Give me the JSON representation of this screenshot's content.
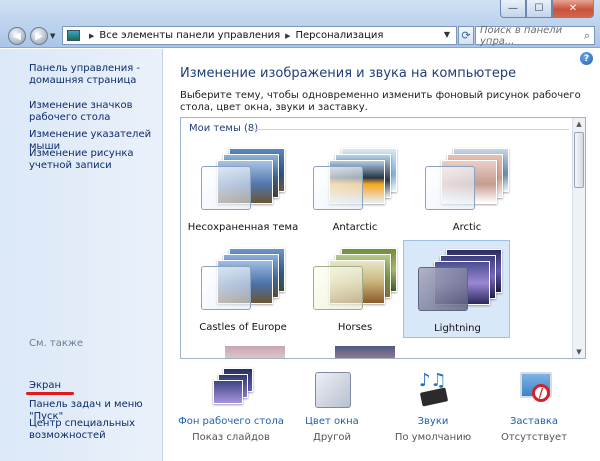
{
  "window": {
    "minimize_glyph": "—",
    "maximize_glyph": "☐",
    "close_glyph": "✕"
  },
  "nav": {
    "back_icon": "arrow-left-icon",
    "forward_icon": "arrow-right-icon",
    "breadcrumb": [
      "Все элементы панели управления",
      "Персонализация"
    ],
    "search_placeholder": "Поиск в панели упра..."
  },
  "sidebar": {
    "links": [
      "Панель управления - домашняя страница",
      "Изменение значков рабочего стола",
      "Изменение указателей мыши",
      "Изменение рисунка учетной записи"
    ],
    "see_also_label": "См. также",
    "see_also_links": [
      "Экран",
      "Панель задач и меню \"Пуск\"",
      "Центр специальных возможностей"
    ],
    "highlight_color": "#e0191a"
  },
  "main": {
    "title": "Изменение изображения и звука на компьютере",
    "description": "Выберите тему, чтобы одновременно изменить фоновый рисунок рабочего стола, цвет окна, звуки и заставку.",
    "group_label": "Мои темы (8)",
    "themes": [
      {
        "name": "Несохраненная тема",
        "selected": false
      },
      {
        "name": "Antarctic",
        "selected": false
      },
      {
        "name": "Arctic",
        "selected": false
      },
      {
        "name": "Castles of Europe",
        "selected": false
      },
      {
        "name": "Horses",
        "selected": false
      },
      {
        "name": "Lightning",
        "selected": true
      }
    ]
  },
  "bottom": [
    {
      "label": "Фон рабочего стола",
      "sub": "Показ слайдов",
      "icon": "desktop-background-icon"
    },
    {
      "label": "Цвет окна",
      "sub": "Другой",
      "icon": "window-color-icon"
    },
    {
      "label": "Звуки",
      "sub": "По умолчанию",
      "icon": "sounds-icon"
    },
    {
      "label": "Заставка",
      "sub": "Отсутствует",
      "icon": "screensaver-icon"
    }
  ],
  "colors": {
    "link": "#0d2b6b",
    "accent_link": "#1f5fb3",
    "title": "#1e3e7a",
    "selection": "#d9e8f9"
  }
}
